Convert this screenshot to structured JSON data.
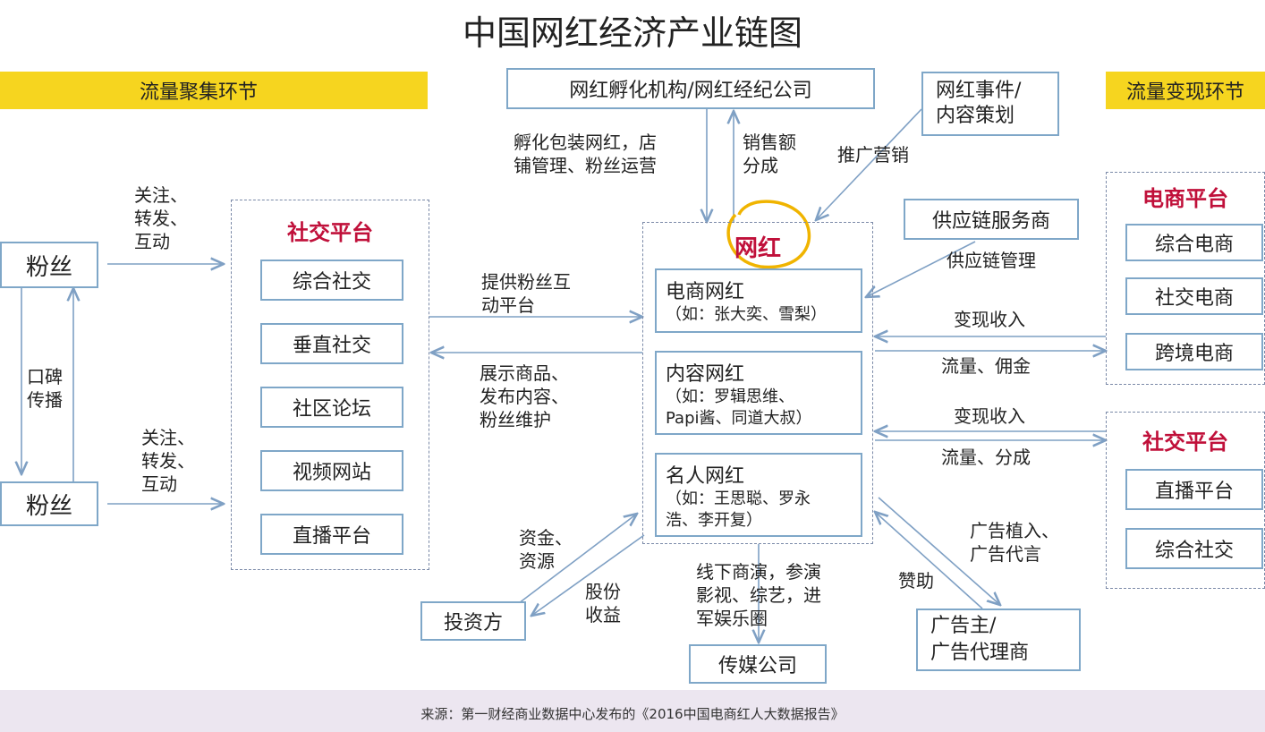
{
  "title": "中国网红经济产业链图",
  "bands": {
    "left": "流量聚集环节",
    "right": "流量变现环节"
  },
  "fans": {
    "top": "粉丝",
    "bottom": "粉丝",
    "word_of_mouth": "口碑\n传播"
  },
  "follow_labels": {
    "top": "关注、\n转发、\n互动",
    "bottom": "关注、\n转发、\n互动"
  },
  "social_platform_left": {
    "title": "社交平台",
    "items": [
      "综合社交",
      "垂直社交",
      "社区论坛",
      "视频网站",
      "直播平台"
    ]
  },
  "incubator": "网红孵化机构/网红经纪公司",
  "incubate_label": "孵化包装网红，店\n铺管理、粉丝运营",
  "sales_label": "销售额\n分成",
  "event": "网红事件/\n内容策划",
  "promo_label": "推广营销",
  "supply": "供应链服务商",
  "supply_label": "供应链管理",
  "influencer": {
    "title": "网红",
    "cards": [
      {
        "name": "电商网红",
        "detail": "（如：张大奕、雪梨）"
      },
      {
        "name": "内容网红",
        "detail": "（如：罗辑思维、\nPapi酱、同道大叔）"
      },
      {
        "name": "名人网红",
        "detail": "（如：王思聪、罗永\n浩、李开复）"
      }
    ]
  },
  "provide_label": "提供粉丝互\n动平台",
  "show_label": "展示商品、\n发布内容、\n粉丝维护",
  "ecommerce": {
    "title": "电商平台",
    "items": [
      "综合电商",
      "社交电商",
      "跨境电商"
    ]
  },
  "monetize1": "变现收入",
  "traffic1": "流量、佣金",
  "monetize2": "变现收入",
  "traffic2": "流量、分成",
  "social_platform_right": {
    "title": "社交平台",
    "items": [
      "直播平台",
      "综合社交"
    ]
  },
  "ad_label": "广告植入、\n广告代言",
  "sponsor_label": "赞助",
  "advertiser": "广告主/\n广告代理商",
  "investor": "投资方",
  "fund_label": "资金、\n资源",
  "equity_label": "股份\n收益",
  "offline_label": "线下商演，参演\n影视、综艺，进\n军娱乐圈",
  "media": "传媒公司",
  "source": "来源：第一财经商业数据中心发布的《2016中国电商红人大数据报告》",
  "colors": {
    "band": "#f6d51f",
    "accent": "#c0103a",
    "border": "#7fa7c8",
    "arrow": "#7fa0c4",
    "highlight": "#f0b400"
  }
}
